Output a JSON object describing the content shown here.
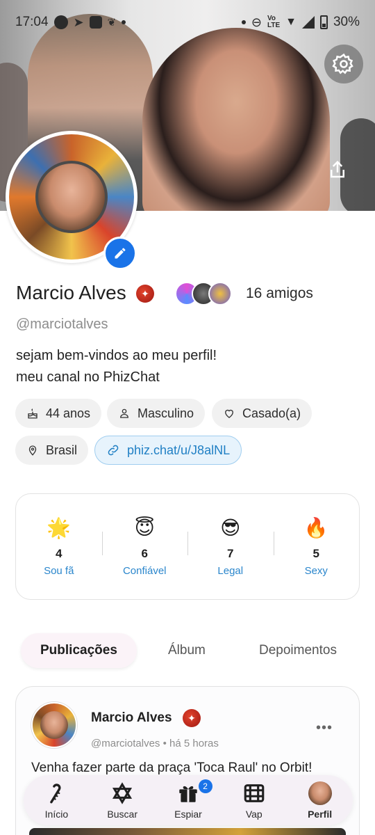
{
  "status_bar": {
    "time": "17:04",
    "battery": "30%"
  },
  "profile": {
    "name": "Marcio Alves",
    "handle": "@marciotalves",
    "friends_count": "16 amigos",
    "bio": [
      "sejam bem-vindos ao meu perfil!",
      "meu canal no PhizChat"
    ],
    "chips": {
      "age": "44 anos",
      "gender": "Masculino",
      "relationship": "Casado(a)",
      "country": "Brasil",
      "link": "phiz.chat/u/J8alNL"
    }
  },
  "reactions": [
    {
      "emoji": "🌟",
      "count": "4",
      "label": "Sou fã"
    },
    {
      "emoji": "😇",
      "count": "6",
      "label": "Confiável"
    },
    {
      "emoji": "😎",
      "count": "7",
      "label": "Legal"
    },
    {
      "emoji": "🔥",
      "count": "5",
      "label": "Sexy"
    }
  ],
  "tabs": [
    "Publicações",
    "Álbum",
    "Depoimentos"
  ],
  "post": {
    "author": "Marcio Alves",
    "handle": "@marciotalves",
    "time": "há 5 horas",
    "more": "•••",
    "text": "Venha fazer parte da praça 'Toca Raul' no Orbit!"
  },
  "bottom_nav": {
    "items": [
      "Início",
      "Buscar",
      "Espiar",
      "Vap",
      "Perfil"
    ],
    "espiar_badge": "2"
  },
  "colors": {
    "accent": "#1a73e8",
    "link": "#1f7fc4",
    "reaction_label": "#2a86cc"
  }
}
